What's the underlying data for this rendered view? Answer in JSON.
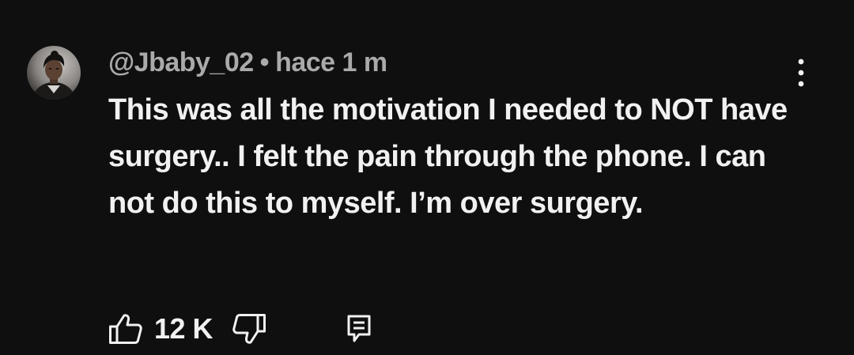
{
  "comment": {
    "author": "@Jbaby_02",
    "separator": "•",
    "timestamp": "hace 1 m",
    "text": "This was all the motivation I needed to NOT have surgery.. I felt the pain through the phone. I can not do this to myself. I’m over surgery.",
    "like_count": "12 K"
  },
  "icons": {
    "avatar": "user-avatar",
    "menu": "more-vert-icon",
    "like": "thumb-up-icon",
    "dislike": "thumb-down-icon",
    "reply": "comment-reply-icon"
  },
  "colors": {
    "background": "#0f0f0f",
    "primary_text": "#f1f1f1",
    "secondary_text": "#aaaaaa"
  }
}
